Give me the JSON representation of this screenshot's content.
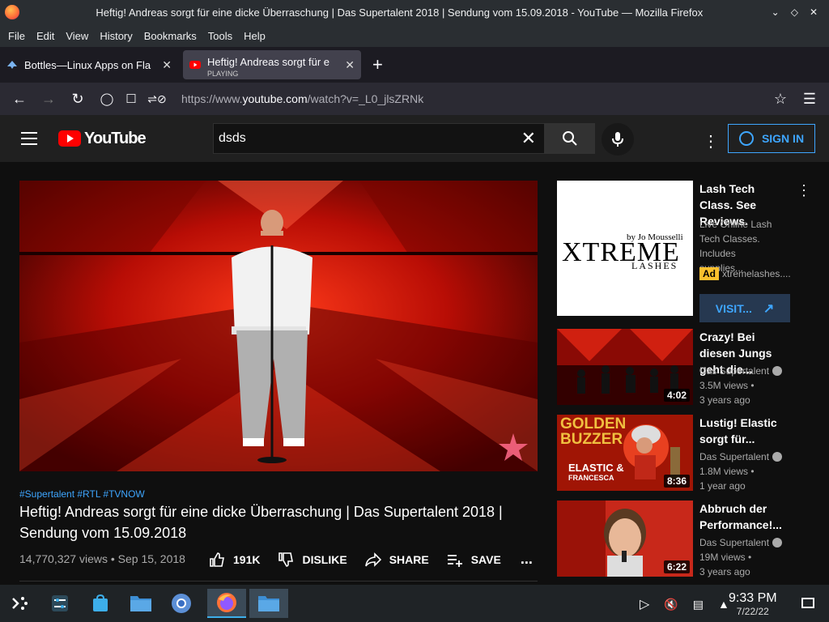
{
  "window": {
    "title": "Heftig! Andreas sorgt für eine dicke Überraschung | Das Supertalent 2018 | Sendung vom 15.09.2018 - YouTube — Mozilla Firefox"
  },
  "menu": [
    "File",
    "Edit",
    "View",
    "History",
    "Bookmarks",
    "Tools",
    "Help"
  ],
  "tabs": [
    {
      "label": "Bottles—Linux Apps on Fla"
    },
    {
      "label": "Heftig! Andreas sorgt für e",
      "sub": "PLAYING"
    }
  ],
  "url": {
    "prefix": "https://www.",
    "host": "youtube.com",
    "path": "/watch?v=_L0_jlsZRNk"
  },
  "youtube": {
    "logo": "YouTube",
    "search_value": "dsds",
    "sign_in": "SIGN IN"
  },
  "video": {
    "hashtags": "#Supertalent #RTL #TVNOW",
    "title": "Heftig! Andreas sorgt für eine dicke Überraschung | Das Supertalent 2018 | Sendung vom 15.09.2018",
    "meta": "14,770,327 views • Sep 15, 2018",
    "likes": "191K",
    "dislike": "DISLIKE",
    "share": "SHARE",
    "save": "SAVE",
    "more": "..."
  },
  "ad": {
    "brand_top": "by Jo Mousselli",
    "brand_main": "XTREME",
    "brand_sub": "LASHES",
    "title": "Lash Tech Class. See Reviews.",
    "desc": "Live Online Lash Tech Classes. Includes supplies...",
    "badge": "Ad",
    "domain": "xtremelashes....",
    "button": "VISIT..."
  },
  "recommendations": [
    {
      "title": "Crazy! Bei diesen Jungs geht die...",
      "channel": "Das Supertalent",
      "views": "3.5M views •",
      "age": "3 years ago",
      "duration": "4:02"
    },
    {
      "title": "Lustig! Elastic sorgt für...",
      "channel": "Das Supertalent",
      "views": "1.8M views •",
      "age": "1 year ago",
      "duration": "8:36",
      "thumb_text": "GOLDEN BUZZER",
      "thumb_sub": "ELASTIC &",
      "thumb_sub2": "FRANCESCA"
    },
    {
      "title": "Abbruch der Performance!...",
      "channel": "Das Supertalent",
      "views": "19M views •",
      "age": "3 years ago",
      "duration": "6:22"
    }
  ],
  "taskbar": {
    "time": "9:33 PM",
    "date": "7/22/22"
  },
  "colors": {
    "yt_red": "#ff0000",
    "link_blue": "#3ea6ff",
    "bg": "#0f0f0f"
  }
}
